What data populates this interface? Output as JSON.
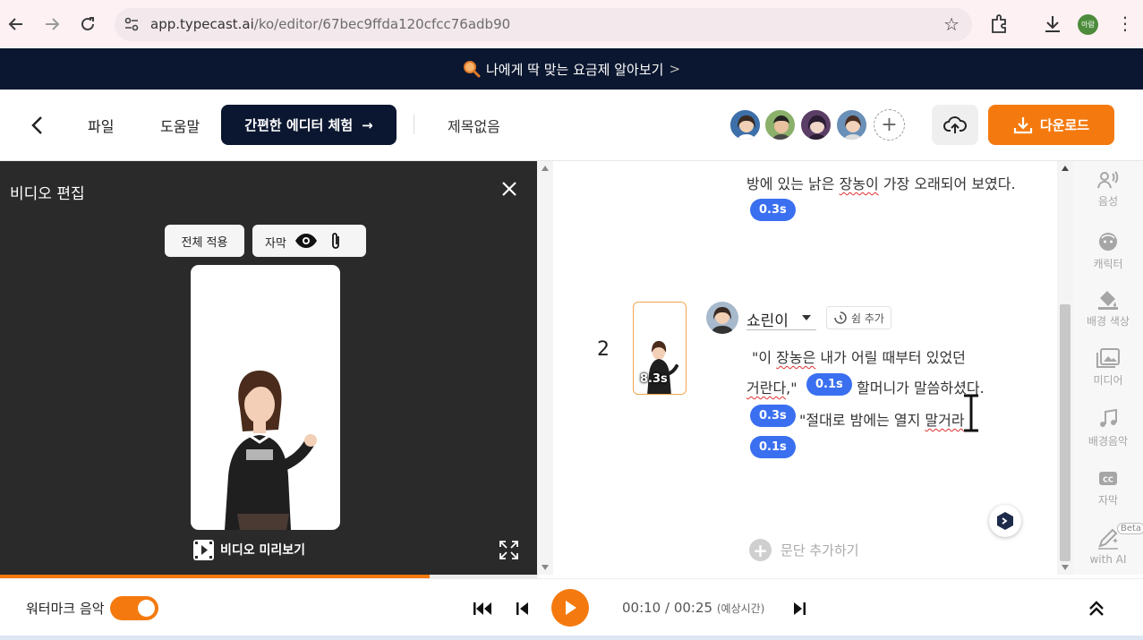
{
  "browser": {
    "url_host": "app.typecast.ai",
    "url_path": "/ko/editor/67bec9ffda120cfcc76adb90",
    "profile_label": "아람"
  },
  "promo": {
    "text": "나에게 딱 맞는 요금제 알아보기",
    "chevron": ">"
  },
  "header": {
    "menu_file": "파일",
    "menu_help": "도움말",
    "easy_editor": "간편한 에디터 체험",
    "easy_editor_arrow": "→",
    "doc_title": "제목없음",
    "download": "다운로드",
    "add_char": "+"
  },
  "video_panel": {
    "title": "비디오 편집",
    "apply_all": "전체 적용",
    "subtitle": "자막",
    "preview_label": "비디오 미리보기",
    "progress": 0.8
  },
  "script": {
    "line_top": "방에 있는 낡은 장농이 가장 오래되어 보였다.",
    "pause_top": "0.3s",
    "paragraph_number": "2",
    "thumb_duration": "8.3s",
    "character_name": "쇼린이",
    "rest_add": "쉼 추가",
    "line1": "\"이 장농은 내가 어릴 때부터 있었던",
    "line2a": "거란다,\"",
    "pause1": "0.1s",
    "line2b": "할머니가 말씀하셨다.",
    "pause2": "0.3s",
    "line3": "\"절대로 밤에는 열지 말거라",
    "pause3": "0.1s",
    "add_paragraph": "문단 추가하기"
  },
  "tools": [
    {
      "label": "음성",
      "icon": "voice-icon"
    },
    {
      "label": "캐릭터",
      "icon": "character-icon"
    },
    {
      "label": "배경 색상",
      "icon": "paint-bucket-icon"
    },
    {
      "label": "미디어",
      "icon": "media-icon"
    },
    {
      "label": "배경음악",
      "icon": "music-icon"
    },
    {
      "label": "자막",
      "icon": "cc-icon"
    },
    {
      "label": "with AI",
      "icon": "ai-edit-icon",
      "badge": "Beta"
    }
  ],
  "player": {
    "watermark_label": "워터마크 음악",
    "watermark_on": true,
    "time_current": "00:10",
    "time_sep": " / ",
    "time_total": "00:25",
    "time_note": "(예상시간)"
  },
  "colors": {
    "accent": "#f47a0f",
    "navy": "#0b1730",
    "pause_blue": "#3a6ff0"
  }
}
